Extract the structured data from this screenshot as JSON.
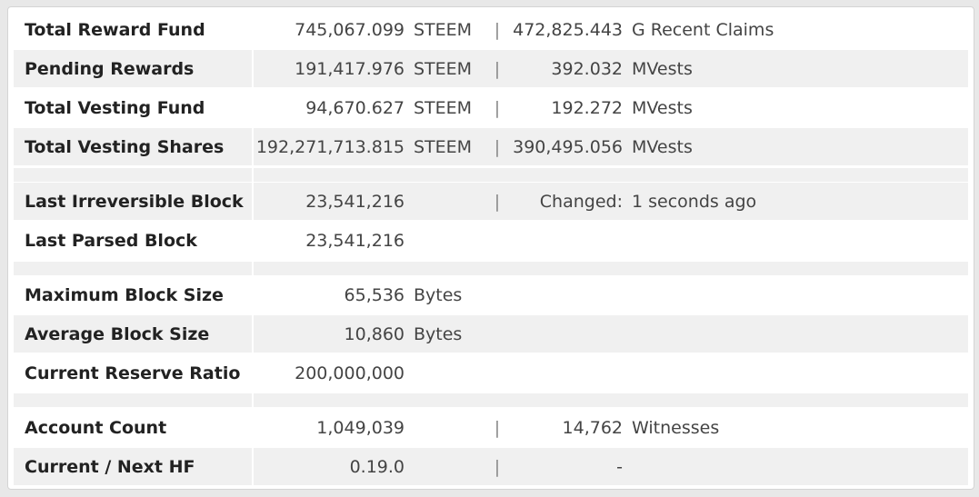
{
  "rows": [
    {
      "label": "Total Reward Fund",
      "value": "745,067.099",
      "unit": "STEEM",
      "sep": "|",
      "value2": "472,825.443",
      "unit2": "G  Recent Claims"
    },
    {
      "label": "Pending Rewards",
      "value": "191,417.976",
      "unit": "STEEM",
      "sep": "|",
      "value2": "392.032",
      "unit2": "MVests"
    },
    {
      "label": "Total Vesting Fund",
      "value": "94,670.627",
      "unit": "STEEM",
      "sep": "|",
      "value2": "192.272",
      "unit2": "MVests"
    },
    {
      "label": "Total Vesting Shares",
      "value": "192,271,713.815",
      "unit": "STEEM",
      "sep": "|",
      "value2": "390,495.056",
      "unit2": "MVests"
    },
    {
      "label": "Last Irreversible Block",
      "value": "23,541,216",
      "unit": "",
      "sep": "|",
      "value2": "Changed:",
      "unit2": "1 seconds ago"
    },
    {
      "label": "Last Parsed Block",
      "value": "23,541,216",
      "unit": "",
      "sep": "",
      "value2": "",
      "unit2": ""
    },
    {
      "label": "Maximum Block Size",
      "value": "65,536",
      "unit": "Bytes",
      "sep": "",
      "value2": "",
      "unit2": ""
    },
    {
      "label": "Average Block Size",
      "value": "10,860",
      "unit": "Bytes",
      "sep": "",
      "value2": "",
      "unit2": ""
    },
    {
      "label": "Current Reserve Ratio",
      "value": "200,000,000",
      "unit": "",
      "sep": "",
      "value2": "",
      "unit2": ""
    },
    {
      "label": "Account Count",
      "value": "1,049,039",
      "unit": "",
      "sep": "|",
      "value2": "14,762",
      "unit2": "Witnesses"
    },
    {
      "label": "Current / Next HF",
      "value": "0.19.0",
      "unit": "",
      "sep": "|",
      "value2": "-",
      "unit2": ""
    }
  ]
}
